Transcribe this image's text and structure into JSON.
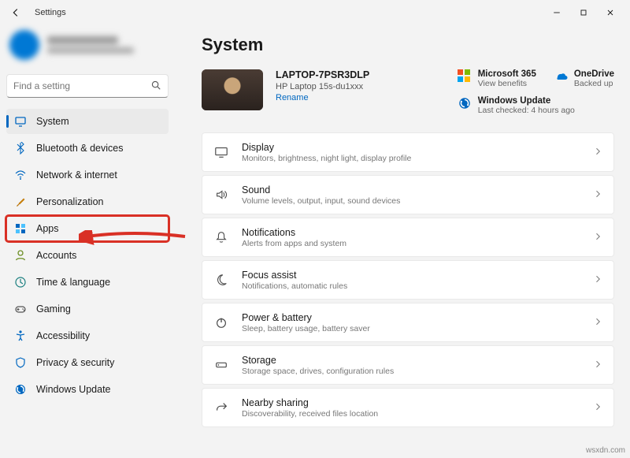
{
  "window": {
    "title": "Settings"
  },
  "search": {
    "placeholder": "Find a setting"
  },
  "sidebar": {
    "items": [
      {
        "label": "System",
        "icon": "system"
      },
      {
        "label": "Bluetooth & devices",
        "icon": "bluetooth"
      },
      {
        "label": "Network & internet",
        "icon": "wifi"
      },
      {
        "label": "Personalization",
        "icon": "brush"
      },
      {
        "label": "Apps",
        "icon": "apps"
      },
      {
        "label": "Accounts",
        "icon": "user"
      },
      {
        "label": "Time & language",
        "icon": "clock"
      },
      {
        "label": "Gaming",
        "icon": "game"
      },
      {
        "label": "Accessibility",
        "icon": "accessibility"
      },
      {
        "label": "Privacy & security",
        "icon": "shield"
      },
      {
        "label": "Windows Update",
        "icon": "update"
      }
    ]
  },
  "main": {
    "heading": "System",
    "device": {
      "name": "LAPTOP-7PSR3DLP",
      "model": "HP Laptop 15s-du1xxx",
      "rename": "Rename"
    },
    "status": [
      {
        "title": "Microsoft 365",
        "sub": "View benefits",
        "icon": "ms365"
      },
      {
        "title": "OneDrive",
        "sub": "Backed up",
        "icon": "onedrive"
      },
      {
        "title": "Windows Update",
        "sub": "Last checked: 4 hours ago",
        "icon": "update"
      }
    ],
    "cards": [
      {
        "title": "Display",
        "sub": "Monitors, brightness, night light, display profile",
        "icon": "display"
      },
      {
        "title": "Sound",
        "sub": "Volume levels, output, input, sound devices",
        "icon": "sound"
      },
      {
        "title": "Notifications",
        "sub": "Alerts from apps and system",
        "icon": "bell"
      },
      {
        "title": "Focus assist",
        "sub": "Notifications, automatic rules",
        "icon": "moon"
      },
      {
        "title": "Power & battery",
        "sub": "Sleep, battery usage, battery saver",
        "icon": "power"
      },
      {
        "title": "Storage",
        "sub": "Storage space, drives, configuration rules",
        "icon": "storage"
      },
      {
        "title": "Nearby sharing",
        "sub": "Discoverability, received files location",
        "icon": "share"
      }
    ]
  },
  "watermark": "wsxdn.com"
}
